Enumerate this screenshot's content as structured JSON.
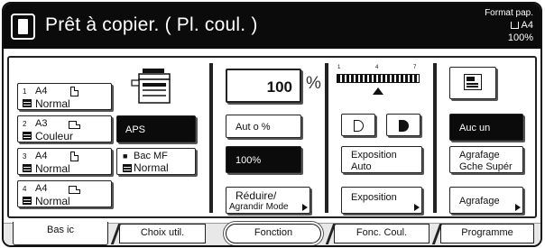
{
  "status": {
    "message": "Prêt à copier. ( Pl. coul. )",
    "paper_label": "Format pap.",
    "paper_size": "A4",
    "zoom": "100%"
  },
  "paper": {
    "cassettes": [
      {
        "num": "1",
        "size": "A4",
        "type": "Normal",
        "orientation": "portrait"
      },
      {
        "num": "2",
        "size": "A3",
        "type": "Couleur",
        "orientation": "landscape"
      },
      {
        "num": "3",
        "size": "A4",
        "type": "Normal",
        "orientation": "portrait"
      },
      {
        "num": "4",
        "size": "A4",
        "type": "Normal",
        "orientation": "landscape"
      }
    ],
    "aps_label": "APS",
    "bypass": {
      "label": "Bac MF",
      "type": "Normal"
    }
  },
  "zoom": {
    "value": "100",
    "unit": "%",
    "auto_label": "Aut o %",
    "preset_label": "100%",
    "reduce_enlarge_line1": "Réduire/",
    "reduce_enlarge_line2": "Agrandir Mode"
  },
  "exposure": {
    "scale_labels": [
      "1",
      "4",
      "7"
    ],
    "level": 4,
    "auto_line1": "Exposition",
    "auto_line2": "Auto",
    "exposure_label": "Exposition"
  },
  "finishing": {
    "none_label": "Auc un",
    "staple_sort_line1": "Agrafage",
    "staple_sort_line2": "Gche Supér",
    "staple_label": "Agrafage"
  },
  "tabs": [
    "Bas ic",
    "Choix util.",
    "Fonction",
    "Fonc. Coul.",
    "Programme"
  ],
  "colors": {
    "status_bar": "#0b0b0b",
    "selected": "#0b0b0b",
    "border": "#222222"
  }
}
